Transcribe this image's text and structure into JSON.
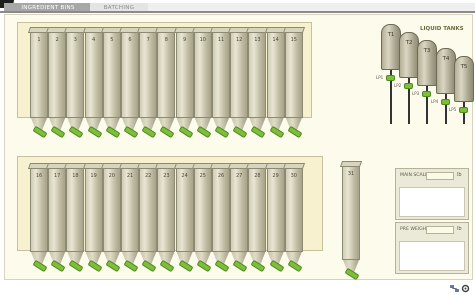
{
  "tabs": [
    {
      "label": "INGREDIENT BINS",
      "active": true
    },
    {
      "label": "BATCHING",
      "active": false
    }
  ],
  "bins_row1": [
    "1",
    "2",
    "3",
    "4",
    "5",
    "6",
    "7",
    "8",
    "9",
    "10",
    "11",
    "12",
    "13",
    "14",
    "15"
  ],
  "bins_row2": [
    "16",
    "17",
    "18",
    "19",
    "20",
    "21",
    "22",
    "23",
    "24",
    "25",
    "26",
    "27",
    "28",
    "29",
    "30"
  ],
  "bin_single": "31",
  "liquid_tanks": {
    "label": "LIQUID TANKS",
    "tanks": [
      "T1",
      "T2",
      "T3",
      "T4",
      "T5"
    ],
    "pump_labels": [
      "LP1",
      "LP2",
      "LP3",
      "LP4",
      "LP5"
    ]
  },
  "scales": [
    {
      "title": "MAIN SCALE",
      "unit": "lb",
      "value": ""
    },
    {
      "title": "PRE WEIGH",
      "unit": "lb",
      "value": ""
    }
  ],
  "colors": {
    "panel_bg": "#fdfcec",
    "bin_bank_bg": "#f7f1d0",
    "valve_green": "#7dbe3a",
    "tab_active": "#a7a7a7"
  }
}
